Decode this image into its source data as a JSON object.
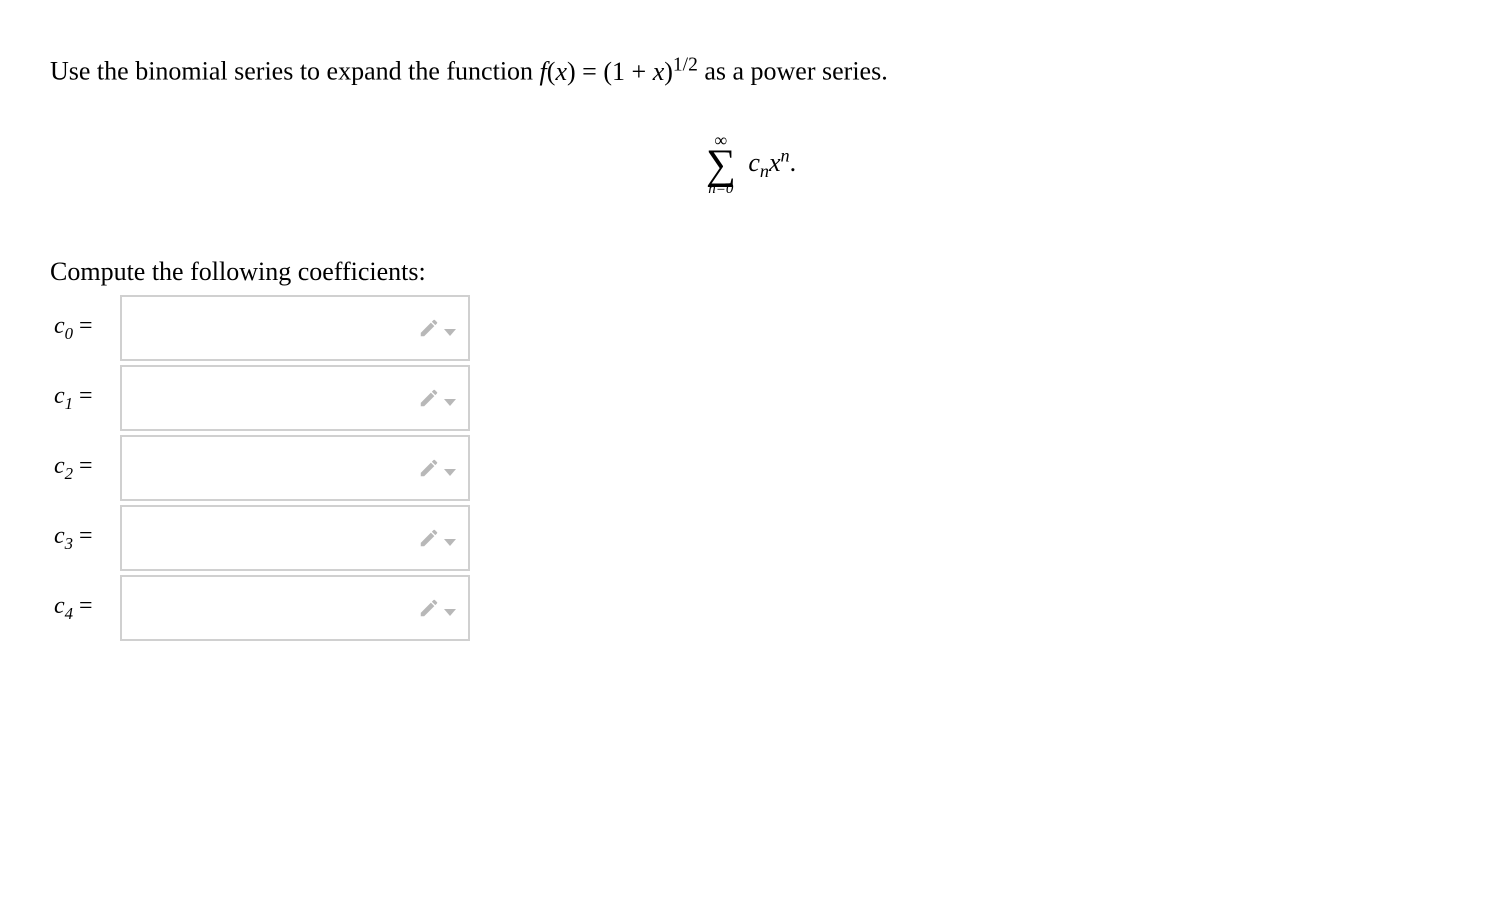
{
  "problem": {
    "intro": "Use the binomial series to expand the function ",
    "func_lhs": "f(x) = (1 + x)",
    "exponent": "1/2",
    "outro": " as a power series."
  },
  "display": {
    "sum_upper": "∞",
    "sum_lower": "n=0",
    "sum_body_cn": "c",
    "sum_body_sub": "n",
    "sum_body_x": "x",
    "sum_body_sup": "n",
    "period": "."
  },
  "instruction": "Compute the following coefficients:",
  "coefficients": [
    {
      "label_c": "c",
      "label_sub": "0",
      "label_eq": "=",
      "value": ""
    },
    {
      "label_c": "c",
      "label_sub": "1",
      "label_eq": "=",
      "value": ""
    },
    {
      "label_c": "c",
      "label_sub": "2",
      "label_eq": "=",
      "value": ""
    },
    {
      "label_c": "c",
      "label_sub": "3",
      "label_eq": "=",
      "value": ""
    },
    {
      "label_c": "c",
      "label_sub": "4",
      "label_eq": "=",
      "value": ""
    }
  ]
}
